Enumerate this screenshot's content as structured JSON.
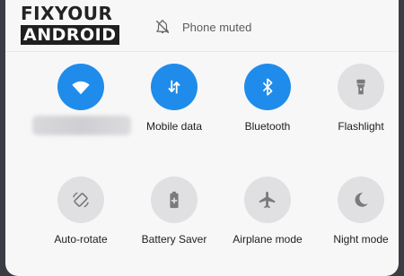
{
  "logo": {
    "line1": "FIXYOUR",
    "line2": "ANDROID"
  },
  "status": {
    "text": "Phone muted",
    "icon": "bell-off-icon"
  },
  "colors": {
    "accent_on": "#1f8ceb",
    "tile_off": "#e0e0e3",
    "panel_bg": "#f7f7f8"
  },
  "tiles": [
    {
      "label": "",
      "icon": "wifi-icon",
      "state": "on"
    },
    {
      "label": "Mobile data",
      "icon": "mobile-data-icon",
      "state": "on"
    },
    {
      "label": "Bluetooth",
      "icon": "bluetooth-icon",
      "state": "on"
    },
    {
      "label": "Flashlight",
      "icon": "flashlight-icon",
      "state": "off"
    },
    {
      "label": "Auto-rotate",
      "icon": "auto-rotate-icon",
      "state": "off"
    },
    {
      "label": "Battery Saver",
      "icon": "battery-saver-icon",
      "state": "off"
    },
    {
      "label": "Airplane mode",
      "icon": "airplane-icon",
      "state": "off"
    },
    {
      "label": "Night mode",
      "icon": "moon-icon",
      "state": "off"
    }
  ]
}
